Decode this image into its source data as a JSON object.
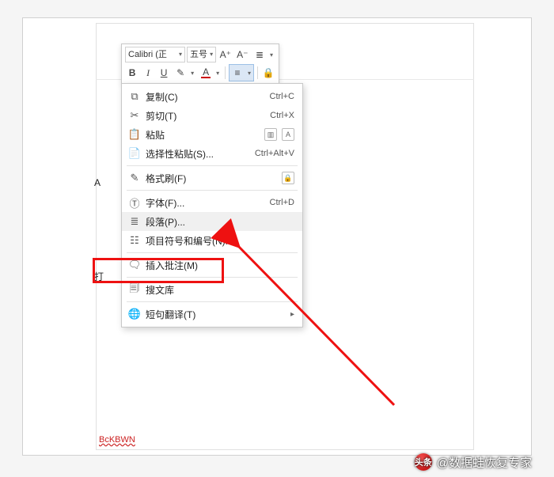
{
  "miniToolbar": {
    "fontName": "Calibri (正",
    "fontSize": "五号",
    "increaseFont": "A⁺",
    "decreaseFont": "A⁻",
    "bold": "B",
    "italic": "I",
    "underline": "U"
  },
  "contextMenu": {
    "copy": {
      "label": "复制(C)",
      "shortcut": "Ctrl+C"
    },
    "cut": {
      "label": "剪切(T)",
      "shortcut": "Ctrl+X"
    },
    "paste": {
      "label": "粘贴"
    },
    "pasteSpecial": {
      "label": "选择性粘贴(S)...",
      "shortcut": "Ctrl+Alt+V"
    },
    "formatPainter": {
      "label": "格式刷(F)"
    },
    "font": {
      "label": "字体(F)...",
      "shortcut": "Ctrl+D"
    },
    "paragraph": {
      "label": "段落(P)..."
    },
    "bullets": {
      "label": "项目符号和编号(N)..."
    },
    "insertComment": {
      "label": "插入批注(M)"
    },
    "searchLibrary": {
      "label": "搜文库"
    },
    "translate": {
      "label": "短句翻译(T)"
    }
  },
  "page": {
    "bottomLabel": "BcKBWN"
  },
  "tips": {
    "a": "A",
    "b": "打"
  },
  "footer": {
    "logoText": "头条",
    "credit": "@数据蛙恢复专家"
  }
}
